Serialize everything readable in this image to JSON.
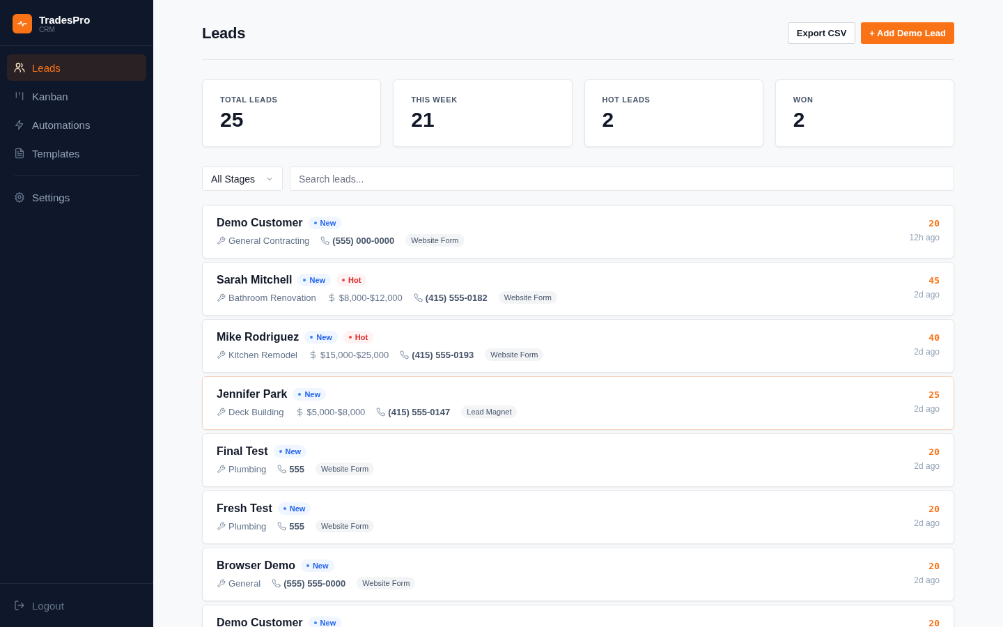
{
  "brand": {
    "name": "TradesPro",
    "subtitle": "CRM"
  },
  "nav": [
    {
      "label": "Leads",
      "kind": "users",
      "selected": true
    },
    {
      "label": "Kanban",
      "kind": "kanban",
      "selected": false
    },
    {
      "label": "Automations",
      "kind": "bolt",
      "selected": false
    },
    {
      "label": "Templates",
      "kind": "doc",
      "selected": false
    },
    {
      "label": "Settings",
      "kind": "gear",
      "selected": false
    }
  ],
  "logout": "Logout",
  "page_title": "Leads",
  "actions": [
    {
      "label": "Export CSV",
      "kind": "secondary"
    },
    {
      "label": "+ Add Demo Lead",
      "kind": "primary"
    }
  ],
  "stats": [
    {
      "label": "TOTAL LEADS",
      "value": "25"
    },
    {
      "label": "THIS WEEK",
      "value": "21"
    },
    {
      "label": "HOT LEADS",
      "value": "2"
    },
    {
      "label": "WON",
      "value": "2"
    }
  ],
  "filter": {
    "stage": "All Stages",
    "placeholder": "Search leads..."
  },
  "leads": [
    {
      "name": "Demo Customer",
      "tags": [
        {
          "label": "New",
          "kind": "new"
        }
      ],
      "meta": [
        {
          "kind": "trade",
          "text": "General Contracting"
        },
        {
          "kind": "phone",
          "text": "(555) 000-0000"
        },
        {
          "kind": "source",
          "text": "Website Form"
        }
      ],
      "score": "20",
      "age": "12h ago",
      "selected": false
    },
    {
      "name": "Sarah Mitchell",
      "tags": [
        {
          "label": "New",
          "kind": "new"
        },
        {
          "label": "Hot",
          "kind": "hot"
        }
      ],
      "meta": [
        {
          "kind": "trade",
          "text": "Bathroom Renovation"
        },
        {
          "kind": "budget",
          "text": "$8,000-$12,000"
        },
        {
          "kind": "phone",
          "text": "(415) 555-0182"
        },
        {
          "kind": "source",
          "text": "Website Form"
        }
      ],
      "score": "45",
      "age": "2d ago",
      "selected": false
    },
    {
      "name": "Mike Rodriguez",
      "tags": [
        {
          "label": "New",
          "kind": "new"
        },
        {
          "label": "Hot",
          "kind": "hot"
        }
      ],
      "meta": [
        {
          "kind": "trade",
          "text": "Kitchen Remodel"
        },
        {
          "kind": "budget",
          "text": "$15,000-$25,000"
        },
        {
          "kind": "phone",
          "text": "(415) 555-0193"
        },
        {
          "kind": "source",
          "text": "Website Form"
        }
      ],
      "score": "40",
      "age": "2d ago",
      "selected": false
    },
    {
      "name": "Jennifer Park",
      "tags": [
        {
          "label": "New",
          "kind": "new"
        }
      ],
      "meta": [
        {
          "kind": "trade",
          "text": "Deck Building"
        },
        {
          "kind": "budget",
          "text": "$5,000-$8,000"
        },
        {
          "kind": "phone",
          "text": "(415) 555-0147"
        },
        {
          "kind": "source",
          "text": "Lead Magnet"
        }
      ],
      "score": "25",
      "age": "2d ago",
      "selected": true
    },
    {
      "name": "Final Test",
      "tags": [
        {
          "label": "New",
          "kind": "new"
        }
      ],
      "meta": [
        {
          "kind": "trade",
          "text": "Plumbing"
        },
        {
          "kind": "phone",
          "text": "555"
        },
        {
          "kind": "source",
          "text": "Website Form"
        }
      ],
      "score": "20",
      "age": "2d ago",
      "selected": false
    },
    {
      "name": "Fresh Test",
      "tags": [
        {
          "label": "New",
          "kind": "new"
        }
      ],
      "meta": [
        {
          "kind": "trade",
          "text": "Plumbing"
        },
        {
          "kind": "phone",
          "text": "555"
        },
        {
          "kind": "source",
          "text": "Website Form"
        }
      ],
      "score": "20",
      "age": "2d ago",
      "selected": false
    },
    {
      "name": "Browser Demo",
      "tags": [
        {
          "label": "New",
          "kind": "new"
        }
      ],
      "meta": [
        {
          "kind": "trade",
          "text": "General"
        },
        {
          "kind": "phone",
          "text": "(555) 555-0000"
        },
        {
          "kind": "source",
          "text": "Website Form"
        }
      ],
      "score": "20",
      "age": "2d ago",
      "selected": false
    },
    {
      "name": "Demo Customer",
      "tags": [
        {
          "label": "New",
          "kind": "new"
        }
      ],
      "score": "20",
      "selected": false
    }
  ]
}
